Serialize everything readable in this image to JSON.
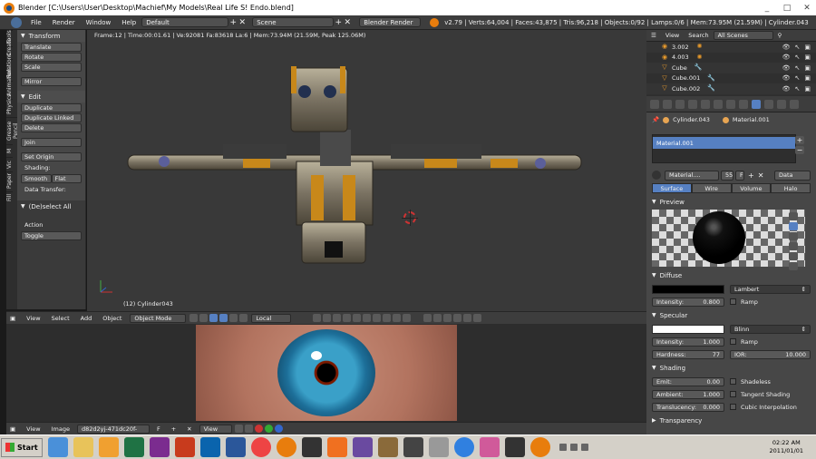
{
  "window": {
    "title": "Blender [C:\\Users\\User\\Desktop\\Machief\\My Models\\Real Life S! Endo.blend]",
    "controls": [
      "_",
      "□",
      "✕"
    ]
  },
  "topbar": {
    "menus": [
      "File",
      "Render",
      "Window",
      "Help"
    ],
    "layout": "Default",
    "scene": "Scene",
    "engine": "Blender Render",
    "stats": "v2.79 | Verts:64,004 | Faces:43,875 | Tris:96,218 | Objects:0/92 | Lamps:0/6 | Mem:73.95M (21.59M) | Cylinder.043"
  },
  "tabs": [
    "Tools",
    "Create",
    "Relations",
    "Animation",
    "Physics",
    "Grease Pencil",
    "M",
    "Vic",
    "Paper",
    "Fill"
  ],
  "toolshelf": {
    "transform_title": "Transform",
    "translate": "Translate",
    "rotate": "Rotate",
    "scale": "Scale",
    "mirror": "Mirror",
    "edit_title": "Edit",
    "duplicate": "Duplicate",
    "duplicate_linked": "Duplicate Linked",
    "delete": "Delete",
    "join": "Join",
    "set_origin": "Set Origin",
    "shading_label": "Shading:",
    "smooth": "Smooth",
    "flat": "Flat",
    "data_transfer": "Data Transfer:",
    "deselect_title": "(De)select All",
    "action_label": "Action",
    "action_value": "Toggle"
  },
  "viewport": {
    "info": "Frame:12 | Time:00:01.61 | Ve:92081 Fa:83618 La:6 | Mem:73.94M (21.59M, Peak 125.06M)",
    "object_label": "(12) Cylinder043"
  },
  "vheader": {
    "view": "View",
    "select": "Select",
    "add": "Add",
    "object": "Object",
    "mode": "Object Mode",
    "orientation": "Local"
  },
  "imgeditor": {
    "view": "View",
    "image": "Image",
    "image_name": "d82d2yj-471dc20f-",
    "view2": "View"
  },
  "outliner": {
    "view": "View",
    "search": "Search",
    "scenes": "All Scenes",
    "rows": [
      {
        "name": "3.002",
        "icon": "lamp-icon"
      },
      {
        "name": "4.003",
        "icon": "lamp-icon"
      },
      {
        "name": "Cube",
        "icon": "mesh-icon"
      },
      {
        "name": "Cube.001",
        "icon": "mesh-icon"
      },
      {
        "name": "Cube.002",
        "icon": "mesh-icon"
      }
    ]
  },
  "props": {
    "crumb_object": "Cylinder.043",
    "crumb_material": "Material.001",
    "material_slot": "Material.001",
    "material_name": "Material....",
    "material_users": "55",
    "material_f": "F",
    "data_mode": "Data",
    "tabs": [
      "Surface",
      "Wire",
      "Volume",
      "Halo"
    ],
    "preview_title": "Preview",
    "diffuse_title": "Diffuse",
    "diffuse_shader": "Lambert",
    "diffuse_color": "#000000",
    "intensity_label": "Intensity:",
    "diffuse_intensity": "0.800",
    "ramp": "Ramp",
    "specular_title": "Specular",
    "specular_shader": "Blinn",
    "specular_color": "#ffffff",
    "spec_intensity": "1.000",
    "hardness_label": "Hardness:",
    "hardness": "77",
    "ior_label": "IOR:",
    "ior": "10.000",
    "shading_title": "Shading",
    "emit_label": "Emit:",
    "emit": "0.00",
    "ambient_label": "Ambient:",
    "ambient": "1.000",
    "translucency_label": "Translucency:",
    "translucency": "0.000",
    "shadeless": "Shadeless",
    "tangent": "Tangent Shading",
    "cubic": "Cubic Interpolation",
    "transparency_title": "Transparency"
  },
  "taskbar": {
    "start": "Start",
    "time": "02:22 AM",
    "date": "2011/01/01"
  },
  "colors": {
    "accent": "#5680c2",
    "blender_orange": "#e87d0d"
  }
}
